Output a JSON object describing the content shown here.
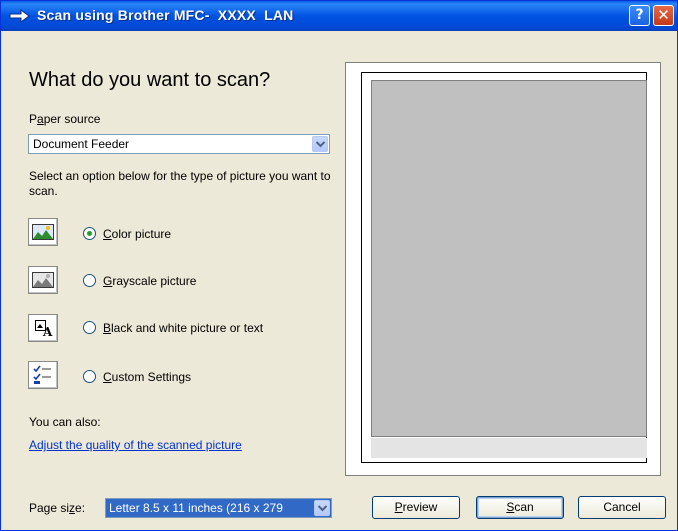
{
  "window": {
    "title": "Scan using Brother MFC-  XXXX  LAN",
    "help_label": "?",
    "close_label": "✕"
  },
  "heading": "What do you want to scan?",
  "paper_source": {
    "label_prefix": "P",
    "label_accel": "a",
    "label_rest": "per source",
    "value": "Document Feeder"
  },
  "instructions": "Select an option below for the type of picture you want to scan.",
  "options": [
    {
      "accel": "C",
      "rest": "olor picture",
      "checked": true,
      "icon": "color-picture-icon"
    },
    {
      "accel": "G",
      "rest": "rayscale picture",
      "checked": false,
      "icon": "grayscale-picture-icon"
    },
    {
      "accel": "B",
      "rest": "lack and white picture or text",
      "checked": false,
      "icon": "black-white-text-icon"
    },
    {
      "accel": "C",
      "rest": "ustom Settings",
      "checked": false,
      "icon": "custom-settings-icon"
    }
  ],
  "also_label": "You can also:",
  "adjust_link": "Adjust the quality of the scanned picture",
  "page_size": {
    "label_prefix": "Page si",
    "label_accel": "z",
    "label_rest": "e:",
    "value": "Letter 8.5 x 11 inches (216 x 279"
  },
  "buttons": {
    "preview_accel": "P",
    "preview_rest": "review",
    "scan_accel": "S",
    "scan_rest": "can",
    "cancel": "Cancel"
  },
  "colors": {
    "titlebar": "#0053e1",
    "dialog_bg": "#ece9d8",
    "link": "#0033cc",
    "selection": "#3169c6",
    "preview_area": "#c0c0c0"
  }
}
